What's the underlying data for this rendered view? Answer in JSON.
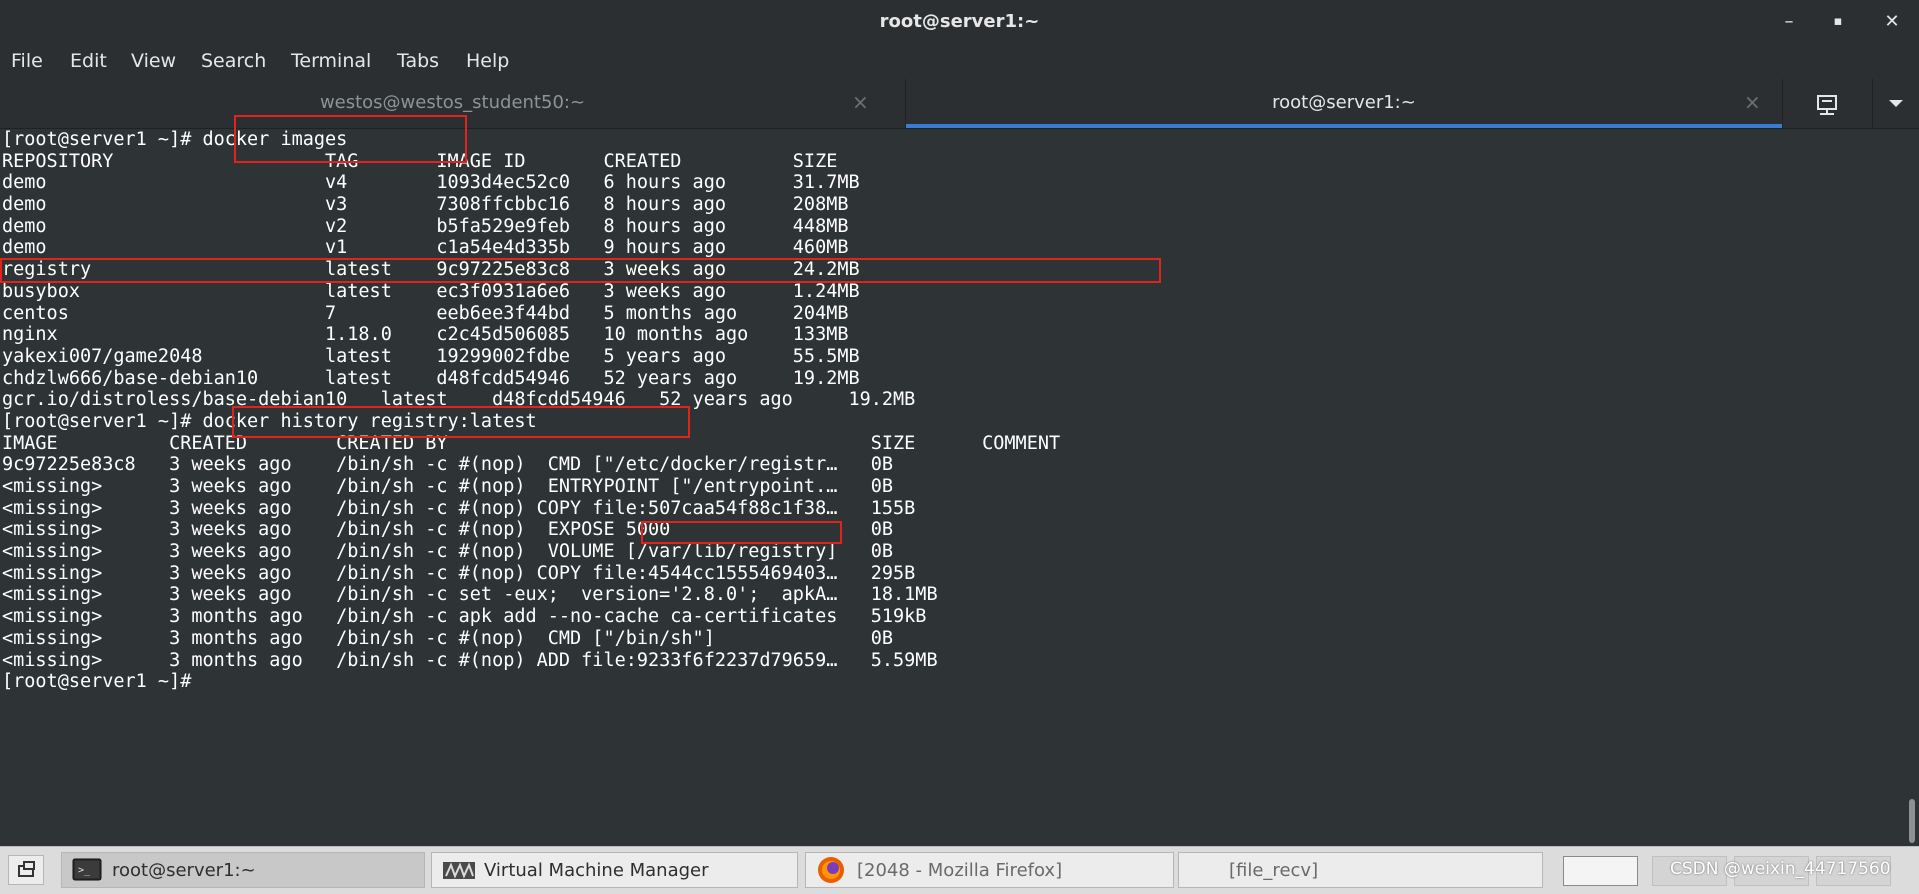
{
  "window": {
    "title": "root@server1:~",
    "minimize_glyph": "–",
    "maximize_glyph": "▪",
    "close_glyph": "✕"
  },
  "menu": [
    "File",
    "Edit",
    "View",
    "Search",
    "Terminal",
    "Tabs",
    "Help"
  ],
  "tabs": [
    {
      "label": "westos@westos_student50:~",
      "active": false
    },
    {
      "label": "root@server1:~",
      "active": true
    }
  ],
  "tab_close_glyph": "×",
  "icons": {
    "new_tab": "new-tab-icon",
    "dropdown": "chevron-down-icon",
    "show_desktop": "show-desktop-icon",
    "terminal_app": "terminal-app-icon",
    "vm_manager": "virtual-machine-manager-icon",
    "firefox": "firefox-icon"
  },
  "colors": {
    "highlight_box": "#e0241b",
    "active_tab_underline": "#3a7bd5",
    "terminal_bg": "#2e3436"
  },
  "terminal_lines": [
    "[root@server1 ~]# docker images",
    "REPOSITORY                   TAG       IMAGE ID       CREATED          SIZE",
    "demo                         v4        1093d4ec52c0   6 hours ago      31.7MB",
    "demo                         v3        7308ffcbbc16   8 hours ago      208MB",
    "demo                         v2        b5fa529e9feb   8 hours ago      448MB",
    "demo                         v1        c1a54e4d335b   9 hours ago      460MB",
    "registry                     latest    9c97225e83c8   3 weeks ago      24.2MB",
    "busybox                      latest    ec3f0931a6e6   3 weeks ago      1.24MB",
    "centos                       7         eeb6ee3f44bd   5 months ago     204MB",
    "nginx                        1.18.0    c2c45d506085   10 months ago    133MB",
    "yakexi007/game2048           latest    19299002fdbe   5 years ago      55.5MB",
    "chdzlw666/base-debian10      latest    d48fcdd54946   52 years ago     19.2MB",
    "gcr.io/distroless/base-debian10   latest    d48fcdd54946   52 years ago     19.2MB",
    "[root@server1 ~]# docker history registry:latest",
    "IMAGE          CREATED        CREATED BY                                      SIZE      COMMENT",
    "9c97225e83c8   3 weeks ago    /bin/sh -c #(nop)  CMD [\"/etc/docker/registr…   0B",
    "<missing>      3 weeks ago    /bin/sh -c #(nop)  ENTRYPOINT [\"/entrypoint.…   0B",
    "<missing>      3 weeks ago    /bin/sh -c #(nop) COPY file:507caa54f88c1f38…   155B",
    "<missing>      3 weeks ago    /bin/sh -c #(nop)  EXPOSE 5000                  0B",
    "<missing>      3 weeks ago    /bin/sh -c #(nop)  VOLUME [/var/lib/registry]   0B",
    "<missing>      3 weeks ago    /bin/sh -c #(nop) COPY file:4544cc1555469403…   295B",
    "<missing>      3 weeks ago    /bin/sh -c set -eux;  version='2.8.0';  apkA…   18.1MB",
    "<missing>      3 months ago   /bin/sh -c apk add --no-cache ca-certificates   519kB",
    "<missing>      3 months ago   /bin/sh -c #(nop)  CMD [\"/bin/sh\"]              0B",
    "<missing>      3 months ago   /bin/sh -c #(nop) ADD file:9233f6f2237d79659…   5.59MB",
    "[root@server1 ~]#"
  ],
  "taskbar": {
    "tasks": [
      {
        "label": "root@server1:~",
        "active": true
      },
      {
        "label": "Virtual Machine Manager",
        "active": false
      },
      {
        "label": "[2048 - Mozilla Firefox]",
        "active": false
      },
      {
        "label": "[file_recv]",
        "active": false
      }
    ],
    "watermark": "CSDN @weixin_44717560"
  }
}
